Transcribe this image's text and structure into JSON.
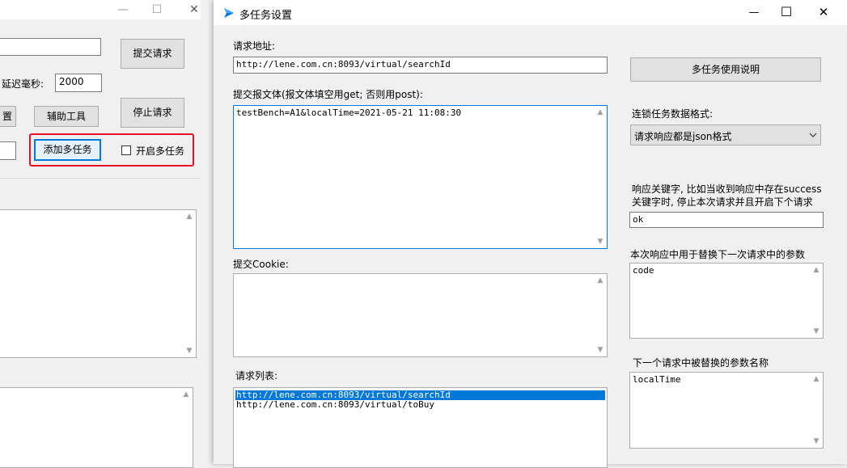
{
  "bg_window": {
    "controls": {
      "minimize": "—",
      "maximize": "☐",
      "close": "✕"
    },
    "submit_button": "提交请求",
    "delay_label": "延迟毫秒:",
    "delay_value": "2000",
    "partial_button": "置",
    "helper_button": "辅助工具",
    "stop_button": "停止请求",
    "add_multitask_button": "添加多任务",
    "enable_multitask_label": "开启多任务",
    "highlight_color": "#e81123"
  },
  "dialog": {
    "title": "多任务设置",
    "controls": {
      "minimize": "—",
      "maximize": "☐",
      "close": "✕"
    },
    "url_label": "请求地址:",
    "url_value": "http://lene.com.cn:8093/virtual/searchId",
    "body_label": "提交报文体(报文体填空用get; 否则用post):",
    "body_value": "testBench=A1&localTime=2021-05-21 11:08:30",
    "cookie_label": "提交Cookie:",
    "cookie_value": "",
    "list_label": "请求列表:",
    "request_list": [
      "http://lene.com.cn:8093/virtual/searchId",
      "http://lene.com.cn:8093/virtual/toBuy"
    ],
    "selected_index": 0,
    "help_button": "多任务使用说明",
    "format_label": "连锁任务数据格式:",
    "format_selected": "请求响应都是json格式",
    "keyword_label_1": "响应关键字, 比如当收到响应中存在success",
    "keyword_label_2": "关键字时, 停止本次请求并且开启下个请求",
    "keyword_value": "ok",
    "replace_label": "本次响应中用于替换下一次请求中的参数",
    "replace_value": "code",
    "param_label": "下一个请求中被替换的参数名称",
    "param_value": "localTime",
    "accent_color": "#0078d7",
    "selection_color": "#0078d7"
  }
}
